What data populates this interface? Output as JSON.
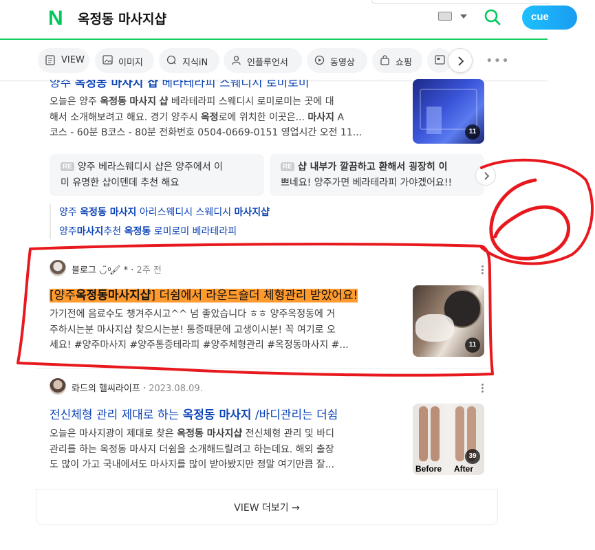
{
  "header": {
    "logo": "N",
    "query": "옥정동 마사지샵",
    "cue_label": "cue"
  },
  "tabs": [
    {
      "label": "VIEW",
      "icon": "view-icon"
    },
    {
      "label": "이미지",
      "icon": "image-icon"
    },
    {
      "label": "지식iN",
      "icon": "kin-icon"
    },
    {
      "label": "인플루언서",
      "icon": "person-icon"
    },
    {
      "label": "동영상",
      "icon": "play-icon"
    },
    {
      "label": "쇼핑",
      "icon": "bag-icon"
    }
  ],
  "results": {
    "r1": {
      "title": [
        "양주 ",
        "옥정동 마사지 샵",
        " 베라테라피 스웨디시 로미로미"
      ],
      "desc": [
        [
          "오늘은 양주 ",
          "옥정동",
          " ",
          "마사지",
          " ",
          "샵",
          " 베라테라피 스웨디시 로미로미는 곳에 대"
        ],
        [
          "해서 소개해보려고 해요. 경기 양주시 ",
          "옥정",
          "로에 위치한 이곳은... ",
          "마사지",
          " A"
        ],
        [
          "코스 - 60분 B코스 - 80분 전화번호 0504-0669-0151 영업시간 오전 11..."
        ]
      ],
      "thumb_count": "11",
      "reviews": [
        {
          "badge": "RE",
          "lines": [
            "양주 베라스웨디시 샵은 양주에서 이",
            "미 유명한 샵이덴데 추천 해요"
          ]
        },
        {
          "badge": "RE",
          "lines": [
            "샵 내부가 깔끔하고 환해서 굉장히 이",
            "쁘네요! 양주가면 베라테라피 가야겠어요!!"
          ]
        }
      ],
      "sublinks": [
        [
          "양주 ",
          "옥정동 마사지",
          " 아리스웨디시 스웨디시 ",
          "마사지샵"
        ],
        [
          "양주",
          "마사지",
          "추천 ",
          "옥정동",
          " 로미로미 베라테라피"
        ]
      ]
    },
    "r2": {
      "source": "블로그 ◡̈ ͦ🖌 *",
      "time": "2주 전",
      "title": [
        "[양주",
        "옥정동마사지샵",
        "] 더쉼에서 라운드숄더 체형관리 받았어요!"
      ],
      "desc": [
        "가기전에 음료수도 챙겨주시고^^ 넘 좋았습니다 ㅎㅎ 양주옥정동에 거",
        "주하시는분 마사지샵 찾으시는분! 통증때문에 고생이시분! 꼭 여기로 오",
        "세요! #양주마사지 #양주통증테라피 #양주체형관리 #옥정동마사지 #..."
      ],
      "thumb_count": "11"
    },
    "r3": {
      "source": "롸드의 헬씨라이프",
      "time": "2023.08.09.",
      "title": [
        "전신체형 관리 제대로 하는 ",
        "옥정동 마사지",
        " /바디관리는 더쉼"
      ],
      "desc": [
        [
          "오늘은 마사지광이 제대로 찾은 ",
          "옥정동 마사지샵",
          " 전신체형 관리 및 바디"
        ],
        [
          "관리를 하는 옥정동 마사지 더쉼을 소개해드릴려고 하는데요. 해외 출장"
        ],
        [
          "도 많이 가고 국내에서도 마사지를 많이 받아봤지만 정말 여기만큼 잘..."
        ]
      ],
      "thumb_before": "Before",
      "thumb_after": "After",
      "thumb_count": "39"
    }
  },
  "more": {
    "label": "VIEW 더보기",
    "arrow": "→"
  },
  "annotation": {
    "number": "6",
    "color": "#e8191e"
  }
}
